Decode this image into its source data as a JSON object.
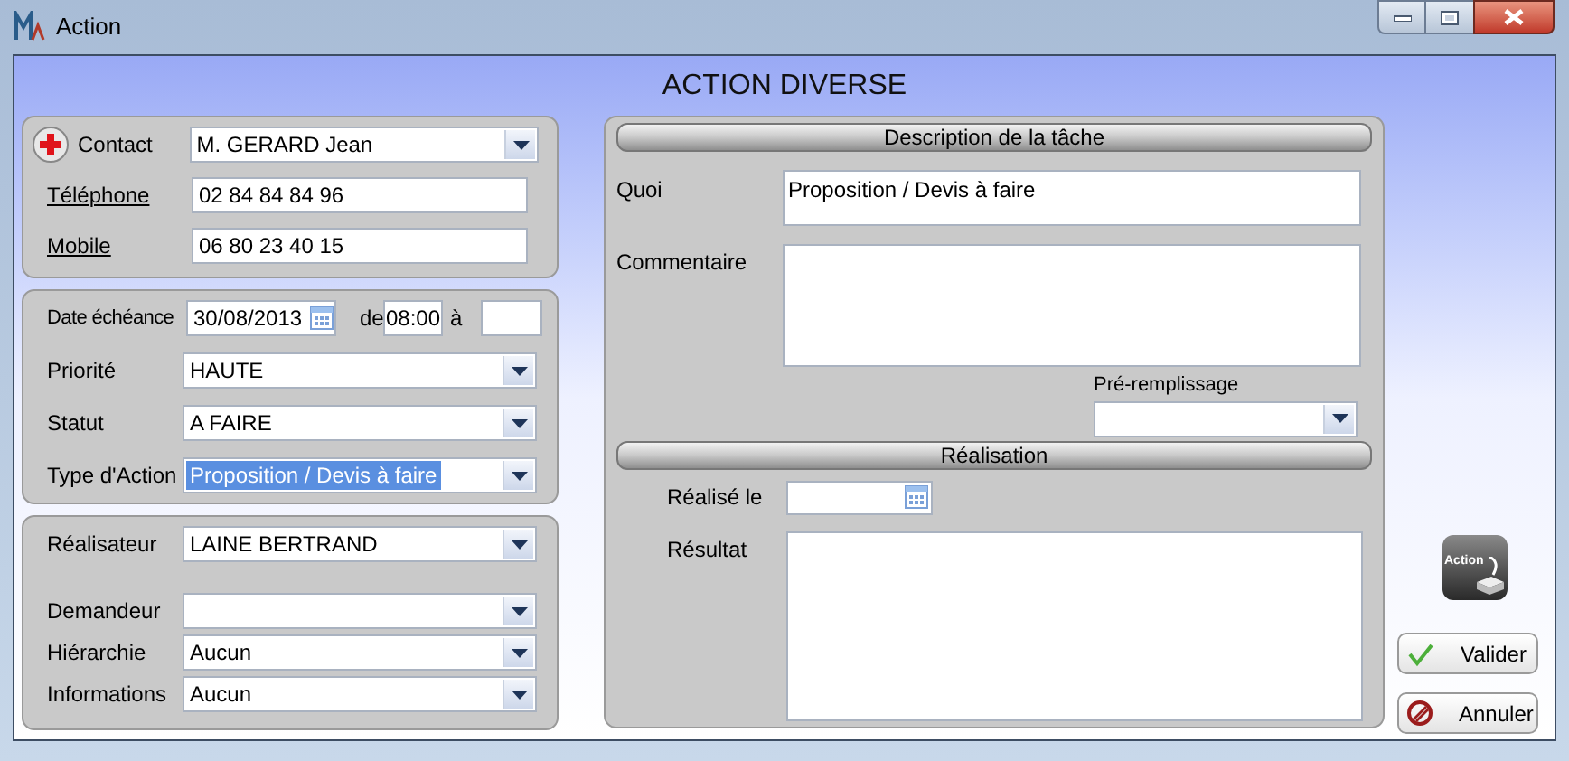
{
  "window": {
    "title": "Action"
  },
  "heading": "ACTION DIVERSE",
  "contact": [
    {
      "label": "Contact",
      "kind": "dropdown",
      "value": "M. GERARD Jean"
    },
    {
      "label": "Téléphone",
      "kind": "text",
      "value": "02 84 84 84 96"
    },
    {
      "label": "Mobile",
      "kind": "text",
      "value": "06 80 23 40 15"
    }
  ],
  "schedule": {
    "date_label": "Date échéance",
    "date": "30/08/2013",
    "from_label": "de",
    "from": "08:00",
    "to_label": "à",
    "fields": [
      {
        "label": "Priorité",
        "value": "HAUTE",
        "highlighted": false
      },
      {
        "label": "Statut",
        "value": "A FAIRE",
        "highlighted": false
      },
      {
        "label": "Type d'Action",
        "value": "Proposition / Devis à faire",
        "highlighted": true
      }
    ]
  },
  "people": [
    {
      "label": "Réalisateur",
      "value": "LAINE BERTRAND"
    },
    {
      "label": "Demandeur"
    },
    {
      "label": "Hiérarchie",
      "value": "Aucun"
    },
    {
      "label": "Informations",
      "value": "Aucun"
    }
  ],
  "description": {
    "title": "Description de la tâche",
    "what_label": "Quoi",
    "what": "Proposition / Devis à faire",
    "comment_label": "Commentaire",
    "prefill_label": "Pré-remplissage"
  },
  "realisation": {
    "title": "Réalisation",
    "done_label": "Réalisé le",
    "result_label": "Résultat"
  },
  "action_icon_label": "Action",
  "buttons": [
    {
      "kind": "ok",
      "label": "Valider"
    },
    {
      "kind": "cancel",
      "label": "Annuler"
    }
  ]
}
